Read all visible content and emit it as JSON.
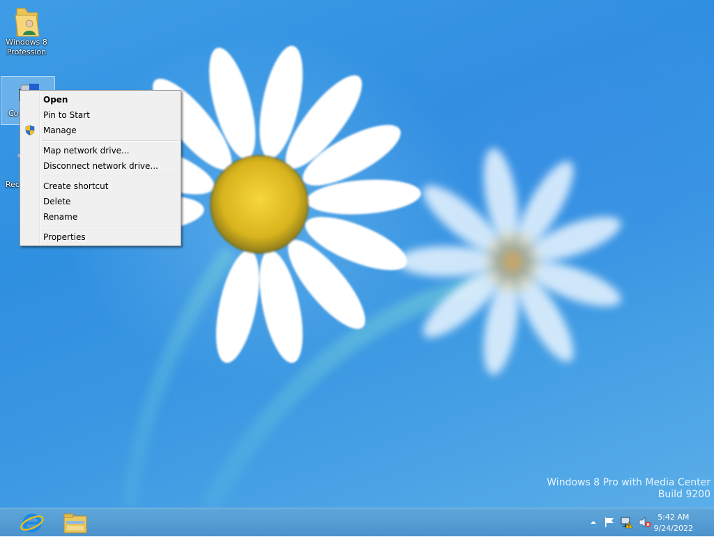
{
  "desktop": {
    "icons": [
      {
        "label_line1": "Windows 8",
        "label_line2": "Profession",
        "icon": "user-folder-icon"
      },
      {
        "label": "Co",
        "icon": "computer-icon"
      },
      {
        "label": "Rec",
        "icon": "recycle-bin-icon"
      }
    ],
    "watermark": {
      "line1": "Windows 8 Pro with Media Center",
      "line2": "Build 9200"
    }
  },
  "context_menu": {
    "items": [
      {
        "label": "Open",
        "bold": true
      },
      {
        "label": "Pin to Start"
      },
      {
        "label": "Manage",
        "icon": "uac-shield-icon"
      },
      {
        "label": "Map network drive..."
      },
      {
        "label": "Disconnect network drive..."
      },
      {
        "label": "Create shortcut"
      },
      {
        "label": "Delete"
      },
      {
        "label": "Rename"
      },
      {
        "label": "Properties"
      }
    ]
  },
  "taskbar": {
    "pinned": [
      {
        "name": "Internet Explorer",
        "icon": "internet-explorer-icon"
      },
      {
        "name": "File Explorer",
        "icon": "file-explorer-icon"
      }
    ],
    "tray_icons": [
      "show-hidden-icons-chevron",
      "action-center-flag-icon",
      "network-icon",
      "volume-muted-icon"
    ],
    "clock": {
      "time": "5:42 AM",
      "date": "9/24/2022"
    }
  },
  "colors": {
    "wallpaper_blue": "#3a97e2",
    "taskbar_blue": "#4a93cd",
    "menu_bg": "#f0f0f0"
  }
}
